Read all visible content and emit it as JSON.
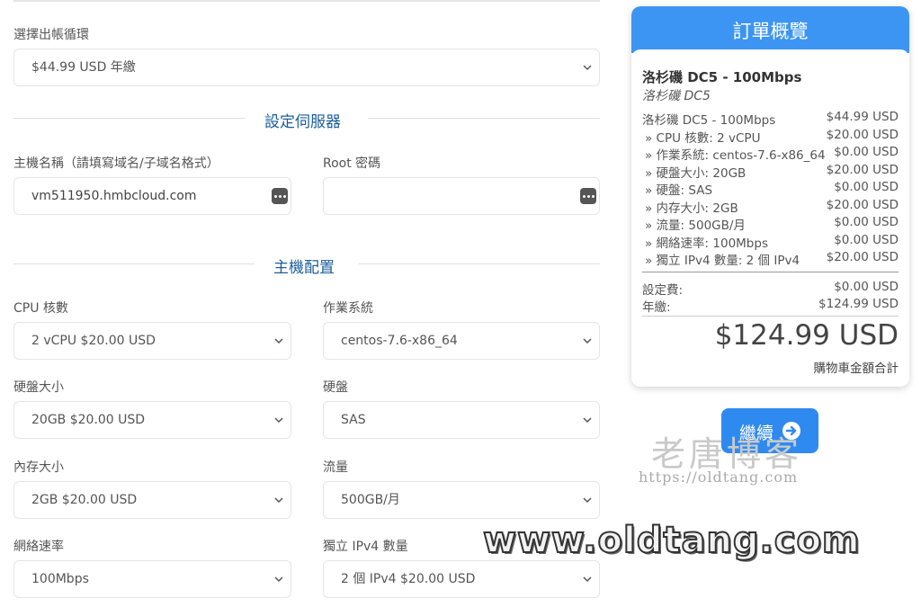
{
  "billing": {
    "label": "選擇出帳循環",
    "value": "$44.99 USD 年繳"
  },
  "server_section": {
    "title": "設定伺服器"
  },
  "hostname": {
    "label": "主機名稱（請填寫域名/子域名格式）",
    "value": "vm511950.hmbcloud.com"
  },
  "rootpw": {
    "label": "Root 密碼",
    "value": ""
  },
  "config_section": {
    "title": "主機配置"
  },
  "options": {
    "cpu": {
      "label": "CPU 核數",
      "value": "2 vCPU $20.00 USD"
    },
    "os": {
      "label": "作業系統",
      "value": "centos-7.6-x86_64"
    },
    "disk_size": {
      "label": "硬盤大小",
      "value": "20GB $20.00 USD"
    },
    "disk_type": {
      "label": "硬盤",
      "value": "SAS"
    },
    "memory": {
      "label": "內存大小",
      "value": "2GB $20.00 USD"
    },
    "traffic": {
      "label": "流量",
      "value": "500GB/月"
    },
    "network": {
      "label": "網絡速率",
      "value": "100Mbps"
    },
    "ipv4": {
      "label": "獨立 IPv4 數量",
      "value": "2 個 IPv4 $20.00 USD"
    }
  },
  "summary": {
    "title": "訂單概覽",
    "product_name": "洛杉磯 DC5 - 100Mbps",
    "product_group": "洛杉磯 DC5",
    "lines": [
      {
        "label": "洛杉磯 DC5 - 100Mbps",
        "price": "$44.99 USD"
      },
      {
        "label": "» CPU 核數: 2 vCPU",
        "price": "$20.00 USD"
      },
      {
        "label": "» 作業系統: centos-7.6-x86_64",
        "price": "$0.00 USD"
      },
      {
        "label": "» 硬盤大小: 20GB",
        "price": "$20.00 USD"
      },
      {
        "label": "» 硬盤: SAS",
        "price": "$0.00 USD"
      },
      {
        "label": "» 内存大小: 2GB",
        "price": "$20.00 USD"
      },
      {
        "label": "» 流量: 500GB/月",
        "price": "$0.00 USD"
      },
      {
        "label": "» 網絡速率: 100Mbps",
        "price": "$0.00 USD"
      },
      {
        "label": "» 獨立 IPv4 數量: 2 個 IPv4",
        "price": "$20.00 USD"
      }
    ],
    "setup_fee": {
      "label": "設定費:",
      "price": "$0.00 USD"
    },
    "annual": {
      "label": "年繳:",
      "price": "$124.99 USD"
    },
    "total": "$124.99 USD",
    "total_caption": "購物車金額合計"
  },
  "continue_button": "繼續",
  "watermark": {
    "site_cn": "老唐博客",
    "url": "https://oldtang.com",
    "big": "www.oldtang.com"
  },
  "colors": {
    "accent": "#3d95f3",
    "section_title": "#1b5e9a"
  },
  "icons": [
    "chevron-down-icon",
    "password-generator-icon",
    "arrow-right-circle-icon"
  ]
}
